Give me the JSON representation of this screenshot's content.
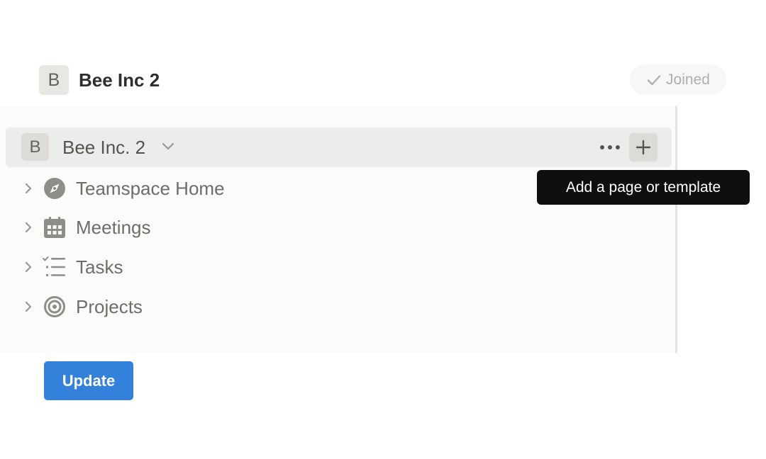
{
  "header": {
    "workspace_initial": "B",
    "workspace_title": "Bee Inc 2",
    "joined_label": "Joined"
  },
  "sidebar": {
    "workspace_row": {
      "initial": "B",
      "name": "Bee Inc. 2"
    },
    "items": [
      {
        "label": "Teamspace Home",
        "icon": "compass-icon"
      },
      {
        "label": "Meetings",
        "icon": "calendar-icon"
      },
      {
        "label": "Tasks",
        "icon": "checklist-icon"
      },
      {
        "label": "Projects",
        "icon": "target-icon"
      }
    ]
  },
  "tooltip": {
    "text": "Add a page or template"
  },
  "footer": {
    "update_label": "Update"
  },
  "colors": {
    "accent": "#3481dc",
    "tooltip_bg": "#0f0f0f",
    "icon_gray": "#8f8d88"
  }
}
